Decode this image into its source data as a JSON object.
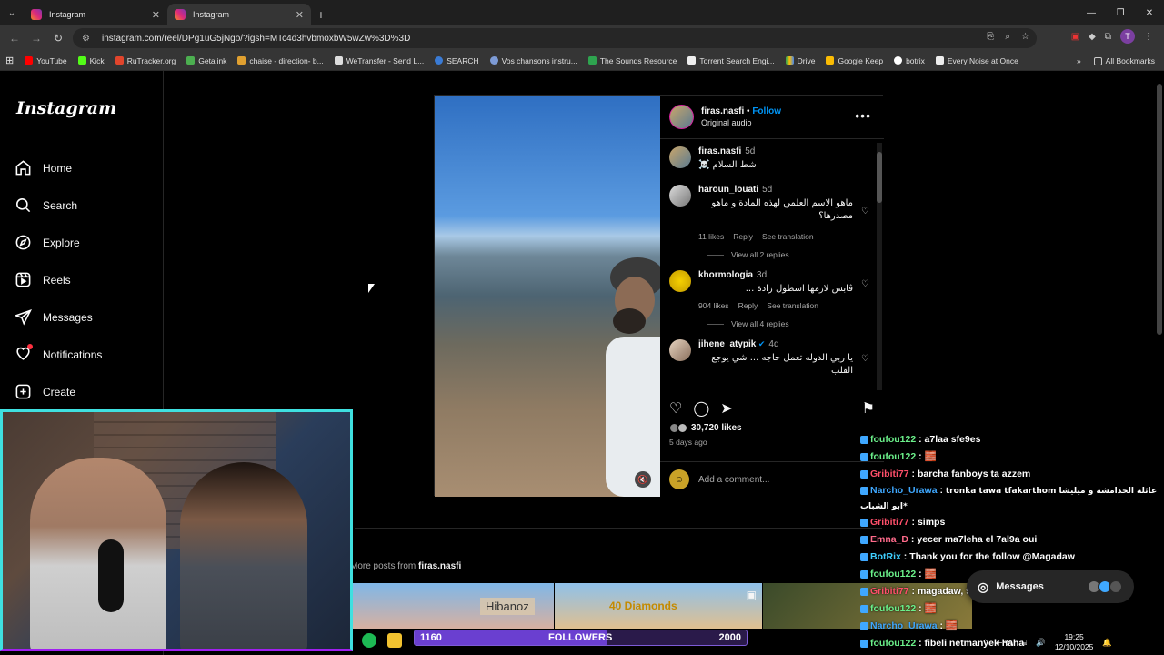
{
  "browser": {
    "tabs": [
      {
        "label": "Instagram",
        "active": false
      },
      {
        "label": "Instagram",
        "active": true
      }
    ],
    "url": "instagram.com/reel/DPg1uG5jNgo/?igsh=MTc4d3hvbmoxbW5wZw%3D%3D",
    "bookmarks": [
      "YouTube",
      "Kick",
      "RuTracker.org",
      "Getalink",
      "chaise - direction- b...",
      "WeTransfer - Send L...",
      "SEARCH",
      "Vos chansons instru...",
      "The Sounds Resource",
      "Torrent Search Engi...",
      "Drive",
      "Google Keep",
      "botrix",
      "Every Noise at Once"
    ],
    "all_bookmarks": "All Bookmarks",
    "profile_initial": "T"
  },
  "sidebar": {
    "logo": "Instagram",
    "items": [
      {
        "label": "Home",
        "icon": "home-icon"
      },
      {
        "label": "Search",
        "icon": "search-icon"
      },
      {
        "label": "Explore",
        "icon": "compass-icon"
      },
      {
        "label": "Reels",
        "icon": "reels-icon"
      },
      {
        "label": "Messages",
        "icon": "send-icon"
      },
      {
        "label": "Notifications",
        "icon": "heart-icon"
      },
      {
        "label": "Create",
        "icon": "plus-square-icon"
      }
    ]
  },
  "post": {
    "author": "firas.nasfi",
    "separator": "•",
    "follow": "Follow",
    "audio": "Original audio",
    "likes": "30,720 likes",
    "posted": "5 days ago",
    "add_comment_placeholder": "Add a comment...",
    "comments": [
      {
        "user": "firas.nasfi",
        "ago": "5d",
        "text": "شط السلام ☠️"
      },
      {
        "user": "haroun_louati",
        "ago": "5d",
        "text": "ماهو الاسم العلمي لهذه المادة و ماهو مصدرها؟",
        "likes": "11 likes",
        "reply": "Reply",
        "translate": "See translation",
        "view_replies": "View all 2 replies"
      },
      {
        "user": "khormologia",
        "ago": "3d",
        "text": "ڨابس لازمها اسطول زادة ...",
        "likes": "904 likes",
        "reply": "Reply",
        "translate": "See translation",
        "view_replies": "View all 4 replies"
      },
      {
        "user": "jihene_atypik",
        "ago": "4d",
        "text": "يا ربي الدوله تعمل حاجه ... شي يوجع القلب"
      }
    ],
    "more_posts_prefix": "More posts from",
    "more_posts_user": "firas.nasfi"
  },
  "thumbnails": {
    "thumb1_text": "Hibanoz",
    "thumb2_text": "40 Diamonds"
  },
  "followers_bar": {
    "current": "1160",
    "label": "FOLLOWERS",
    "goal": "2000",
    "progress": 0.58
  },
  "chat": [
    {
      "user": "foufou122",
      "msg": "a7laa sfe9es"
    },
    {
      "user": "foufou122",
      "msg": "🧱"
    },
    {
      "user": "Gribiti77",
      "msg": "barcha fanboys ta azzem",
      "color": "#ff4f6a"
    },
    {
      "user": "Narcho_Urawa",
      "msg": "tronka tawa tfakarthom عائلة الخدامشة و ميليشا ابو الشباب*",
      "color": "#3fa8ff"
    },
    {
      "user": "Gribiti77",
      "msg": "simps",
      "color": "#ff4f6a"
    },
    {
      "user": "Emna_D",
      "msg": "yecer ma7leha el 7al9a oui",
      "color": "#ff6b8b"
    },
    {
      "user": "BotRix",
      "msg": "Thank you for the follow @Magadaw",
      "color": "#3fd0ff"
    },
    {
      "user": "foufou122",
      "msg": "🧱"
    },
    {
      "user": "Gribiti77",
      "msg": "magadaw, 9oul aaa",
      "color": "#ff4f6a"
    },
    {
      "user": "foufou122",
      "msg": "🧱"
    },
    {
      "user": "Narcho_Urawa",
      "msg": "🧱",
      "color": "#3fa8ff"
    },
    {
      "user": "foufou122",
      "msg": "fibeli netmanyek haha"
    }
  ],
  "messages_pill": "Messages",
  "tray": {
    "lang": "FRA",
    "time": "19:25",
    "date": "12/10/2025"
  }
}
